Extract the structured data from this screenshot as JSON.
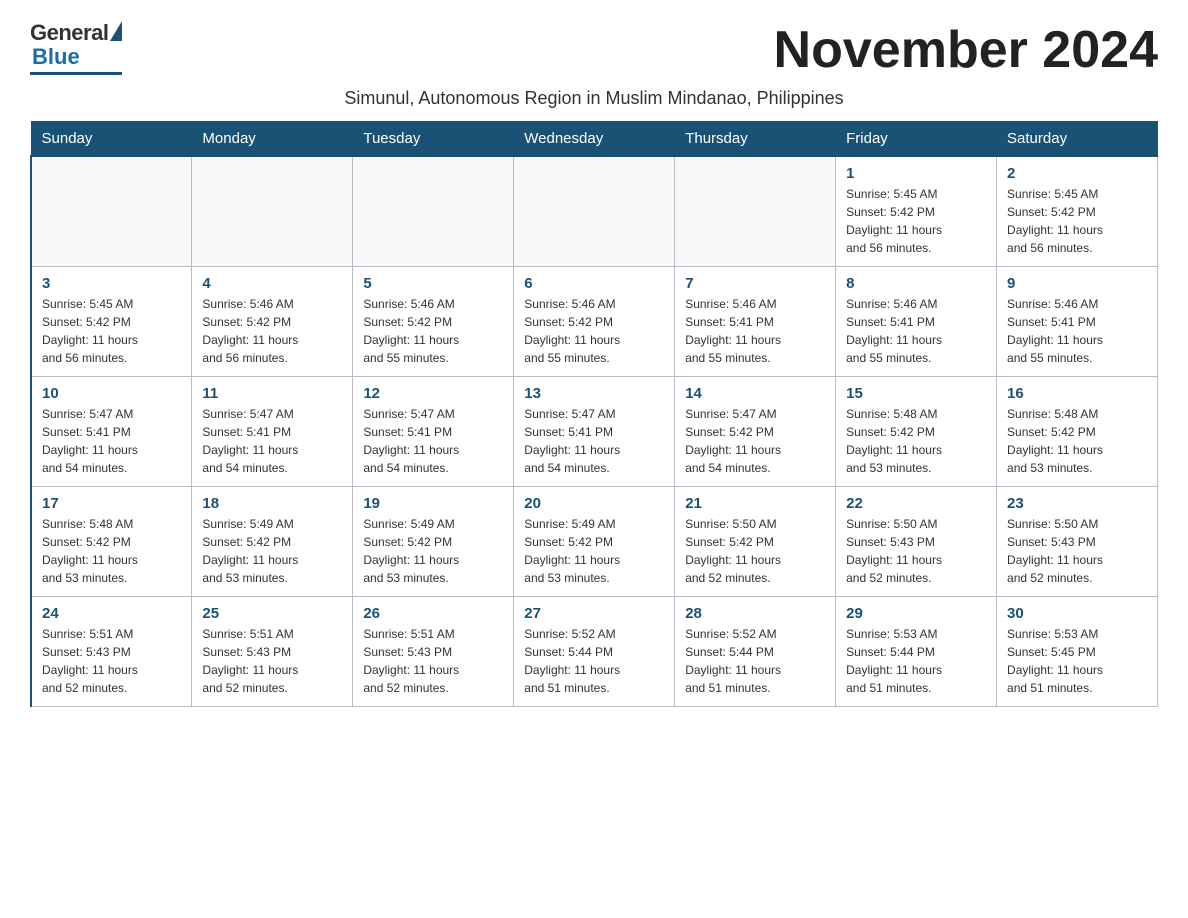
{
  "logo": {
    "general": "General",
    "blue": "Blue"
  },
  "title": "November 2024",
  "subtitle": "Simunul, Autonomous Region in Muslim Mindanao, Philippines",
  "days_of_week": [
    "Sunday",
    "Monday",
    "Tuesday",
    "Wednesday",
    "Thursday",
    "Friday",
    "Saturday"
  ],
  "weeks": [
    [
      {
        "day": "",
        "info": ""
      },
      {
        "day": "",
        "info": ""
      },
      {
        "day": "",
        "info": ""
      },
      {
        "day": "",
        "info": ""
      },
      {
        "day": "",
        "info": ""
      },
      {
        "day": "1",
        "info": "Sunrise: 5:45 AM\nSunset: 5:42 PM\nDaylight: 11 hours\nand 56 minutes."
      },
      {
        "day": "2",
        "info": "Sunrise: 5:45 AM\nSunset: 5:42 PM\nDaylight: 11 hours\nand 56 minutes."
      }
    ],
    [
      {
        "day": "3",
        "info": "Sunrise: 5:45 AM\nSunset: 5:42 PM\nDaylight: 11 hours\nand 56 minutes."
      },
      {
        "day": "4",
        "info": "Sunrise: 5:46 AM\nSunset: 5:42 PM\nDaylight: 11 hours\nand 56 minutes."
      },
      {
        "day": "5",
        "info": "Sunrise: 5:46 AM\nSunset: 5:42 PM\nDaylight: 11 hours\nand 55 minutes."
      },
      {
        "day": "6",
        "info": "Sunrise: 5:46 AM\nSunset: 5:42 PM\nDaylight: 11 hours\nand 55 minutes."
      },
      {
        "day": "7",
        "info": "Sunrise: 5:46 AM\nSunset: 5:41 PM\nDaylight: 11 hours\nand 55 minutes."
      },
      {
        "day": "8",
        "info": "Sunrise: 5:46 AM\nSunset: 5:41 PM\nDaylight: 11 hours\nand 55 minutes."
      },
      {
        "day": "9",
        "info": "Sunrise: 5:46 AM\nSunset: 5:41 PM\nDaylight: 11 hours\nand 55 minutes."
      }
    ],
    [
      {
        "day": "10",
        "info": "Sunrise: 5:47 AM\nSunset: 5:41 PM\nDaylight: 11 hours\nand 54 minutes."
      },
      {
        "day": "11",
        "info": "Sunrise: 5:47 AM\nSunset: 5:41 PM\nDaylight: 11 hours\nand 54 minutes."
      },
      {
        "day": "12",
        "info": "Sunrise: 5:47 AM\nSunset: 5:41 PM\nDaylight: 11 hours\nand 54 minutes."
      },
      {
        "day": "13",
        "info": "Sunrise: 5:47 AM\nSunset: 5:41 PM\nDaylight: 11 hours\nand 54 minutes."
      },
      {
        "day": "14",
        "info": "Sunrise: 5:47 AM\nSunset: 5:42 PM\nDaylight: 11 hours\nand 54 minutes."
      },
      {
        "day": "15",
        "info": "Sunrise: 5:48 AM\nSunset: 5:42 PM\nDaylight: 11 hours\nand 53 minutes."
      },
      {
        "day": "16",
        "info": "Sunrise: 5:48 AM\nSunset: 5:42 PM\nDaylight: 11 hours\nand 53 minutes."
      }
    ],
    [
      {
        "day": "17",
        "info": "Sunrise: 5:48 AM\nSunset: 5:42 PM\nDaylight: 11 hours\nand 53 minutes."
      },
      {
        "day": "18",
        "info": "Sunrise: 5:49 AM\nSunset: 5:42 PM\nDaylight: 11 hours\nand 53 minutes."
      },
      {
        "day": "19",
        "info": "Sunrise: 5:49 AM\nSunset: 5:42 PM\nDaylight: 11 hours\nand 53 minutes."
      },
      {
        "day": "20",
        "info": "Sunrise: 5:49 AM\nSunset: 5:42 PM\nDaylight: 11 hours\nand 53 minutes."
      },
      {
        "day": "21",
        "info": "Sunrise: 5:50 AM\nSunset: 5:42 PM\nDaylight: 11 hours\nand 52 minutes."
      },
      {
        "day": "22",
        "info": "Sunrise: 5:50 AM\nSunset: 5:43 PM\nDaylight: 11 hours\nand 52 minutes."
      },
      {
        "day": "23",
        "info": "Sunrise: 5:50 AM\nSunset: 5:43 PM\nDaylight: 11 hours\nand 52 minutes."
      }
    ],
    [
      {
        "day": "24",
        "info": "Sunrise: 5:51 AM\nSunset: 5:43 PM\nDaylight: 11 hours\nand 52 minutes."
      },
      {
        "day": "25",
        "info": "Sunrise: 5:51 AM\nSunset: 5:43 PM\nDaylight: 11 hours\nand 52 minutes."
      },
      {
        "day": "26",
        "info": "Sunrise: 5:51 AM\nSunset: 5:43 PM\nDaylight: 11 hours\nand 52 minutes."
      },
      {
        "day": "27",
        "info": "Sunrise: 5:52 AM\nSunset: 5:44 PM\nDaylight: 11 hours\nand 51 minutes."
      },
      {
        "day": "28",
        "info": "Sunrise: 5:52 AM\nSunset: 5:44 PM\nDaylight: 11 hours\nand 51 minutes."
      },
      {
        "day": "29",
        "info": "Sunrise: 5:53 AM\nSunset: 5:44 PM\nDaylight: 11 hours\nand 51 minutes."
      },
      {
        "day": "30",
        "info": "Sunrise: 5:53 AM\nSunset: 5:45 PM\nDaylight: 11 hours\nand 51 minutes."
      }
    ]
  ]
}
